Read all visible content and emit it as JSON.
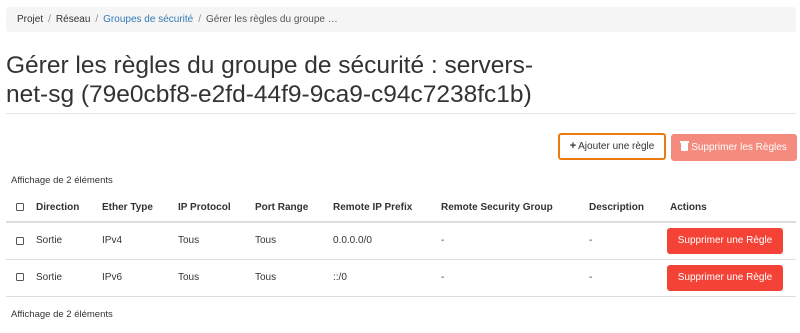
{
  "breadcrumb": {
    "items": [
      "Projet",
      "Réseau",
      "Groupes de sécurité",
      "Gérer les règles du groupe …"
    ],
    "separator": "/"
  },
  "page": {
    "title": "Gérer les règles du groupe de sécurité : servers-net-sg (79e0cbf8-e2fd-44f9-9ca9-c94c7238fc1b)",
    "title_line1": "Gérer les règles du groupe de sécurité : servers-",
    "title_line2": "net-sg (79e0cbf8-e2fd-44f9-9ca9-c94c7238fc1b)"
  },
  "toolbar": {
    "add_rule_label": "Ajouter une règle",
    "add_rule_icon": "plus-icon",
    "delete_rules_label": "Supprimer les Règles",
    "delete_rules_icon": "trash-icon"
  },
  "table": {
    "count_top": "Affichage de 2 éléments",
    "count_bottom": "Affichage de 2 éléments",
    "headers": [
      "Direction",
      "Ether Type",
      "IP Protocol",
      "Port Range",
      "Remote IP Prefix",
      "Remote Security Group",
      "Description",
      "Actions"
    ],
    "rows": [
      {
        "direction": "Sortie",
        "ether_type": "IPv4",
        "ip_protocol": "Tous",
        "port_range": "Tous",
        "remote_ip_prefix": "0.0.0.0/0",
        "remote_security_group": "-",
        "description": "-",
        "action_label": "Supprimer une Règle"
      },
      {
        "direction": "Sortie",
        "ether_type": "IPv6",
        "ip_protocol": "Tous",
        "port_range": "Tous",
        "remote_ip_prefix": "::/0",
        "remote_security_group": "-",
        "description": "-",
        "action_label": "Supprimer une Règle"
      }
    ]
  },
  "colors": {
    "link": "#337ab7",
    "highlight_border": "#ec7a12",
    "danger": "#f44336",
    "danger_disabled": "#f48b7e"
  }
}
